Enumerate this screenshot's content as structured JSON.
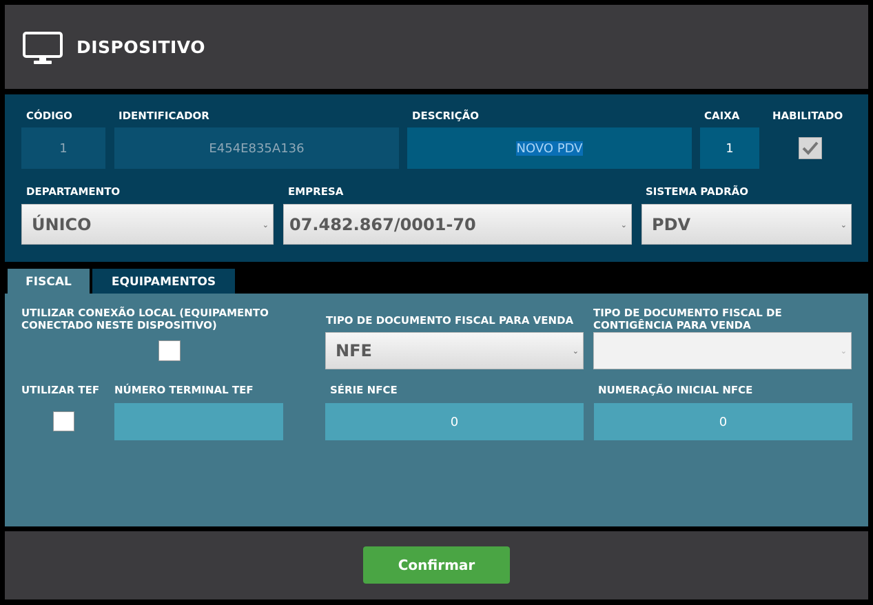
{
  "header": {
    "icon": "monitor-icon",
    "title": "DISPOSITIVO"
  },
  "device": {
    "codigo_label": "CÓDIGO",
    "codigo_value": "1",
    "identificador_label": "IDENTIFICADOR",
    "identificador_value": "E454E835A136",
    "descricao_label": "DESCRIÇÃO",
    "descricao_value": "NOVO PDV",
    "caixa_label": "CAIXA",
    "caixa_value": "1",
    "habilitado_label": "HABILITADO",
    "habilitado_checked": true,
    "departamento_label": "DEPARTAMENTO",
    "departamento_value": "ÚNICO",
    "empresa_label": "EMPRESA",
    "empresa_value": "07.482.867/0001-70",
    "sistema_label": "SISTEMA PADRÃO",
    "sistema_value": "PDV"
  },
  "tabs": [
    {
      "label": "FISCAL",
      "active": true
    },
    {
      "label": "EQUIPAMENTOS",
      "active": false
    }
  ],
  "fiscal": {
    "conexao_label_line1": "UTILIZAR CONEXÃO LOCAL (EQUIPAMENTO",
    "conexao_label_line2": "CONECTADO NESTE DISPOSITIVO)",
    "conexao_checked": false,
    "tipo_doc_label": "TIPO DE DOCUMENTO FISCAL PARA VENDA",
    "tipo_doc_value": "NFE",
    "contingencia_label_line1": "TIPO DE DOCUMENTO FISCAL DE",
    "contingencia_label_line2": "CONTIGÊNCIA PARA VENDA",
    "contingencia_value": "",
    "tef_label": "UTILIZAR TEF",
    "tef_checked": false,
    "terminal_label": "NÚMERO TERMINAL TEF",
    "terminal_value": "",
    "serie_label": "SÉRIE NFCE",
    "serie_value": "0",
    "numeracao_label": "NUMERAÇÃO INICIAL NFCE",
    "numeracao_value": "0"
  },
  "footer": {
    "confirm_label": "Confirmar"
  },
  "colors": {
    "header_bg": "#3c3b3e",
    "top_panel_bg": "#053f5a",
    "fiscal_panel_bg": "#43788a",
    "confirm_bg": "#4aa544"
  }
}
